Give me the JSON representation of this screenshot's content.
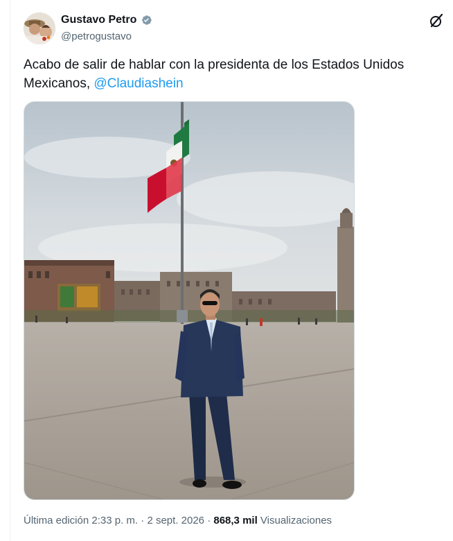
{
  "author": {
    "display_name": "Gustavo Petro",
    "handle": "@petrogustavo",
    "verified": true,
    "avatar_icon": "avatar-photo"
  },
  "toolbar": {
    "grok_icon": "grok-icon"
  },
  "tweet": {
    "text_line1": "Acabo de salir de hablar con la presidenta de los Estados Unidos",
    "text_line2_prefix": "Mexicanos, ",
    "mention": "@Claudiashein"
  },
  "footer": {
    "edited_label": "Última edición",
    "time": "2:33 p. m.",
    "separator": "·",
    "date": "2 sept. 2026",
    "views_count": "868,3 mil",
    "views_label": "Visualizaciones"
  },
  "colors": {
    "text": "#0f1419",
    "secondary": "#536471",
    "link": "#1d9bf0",
    "verified": "#829aab",
    "border": "#cfd9de"
  }
}
